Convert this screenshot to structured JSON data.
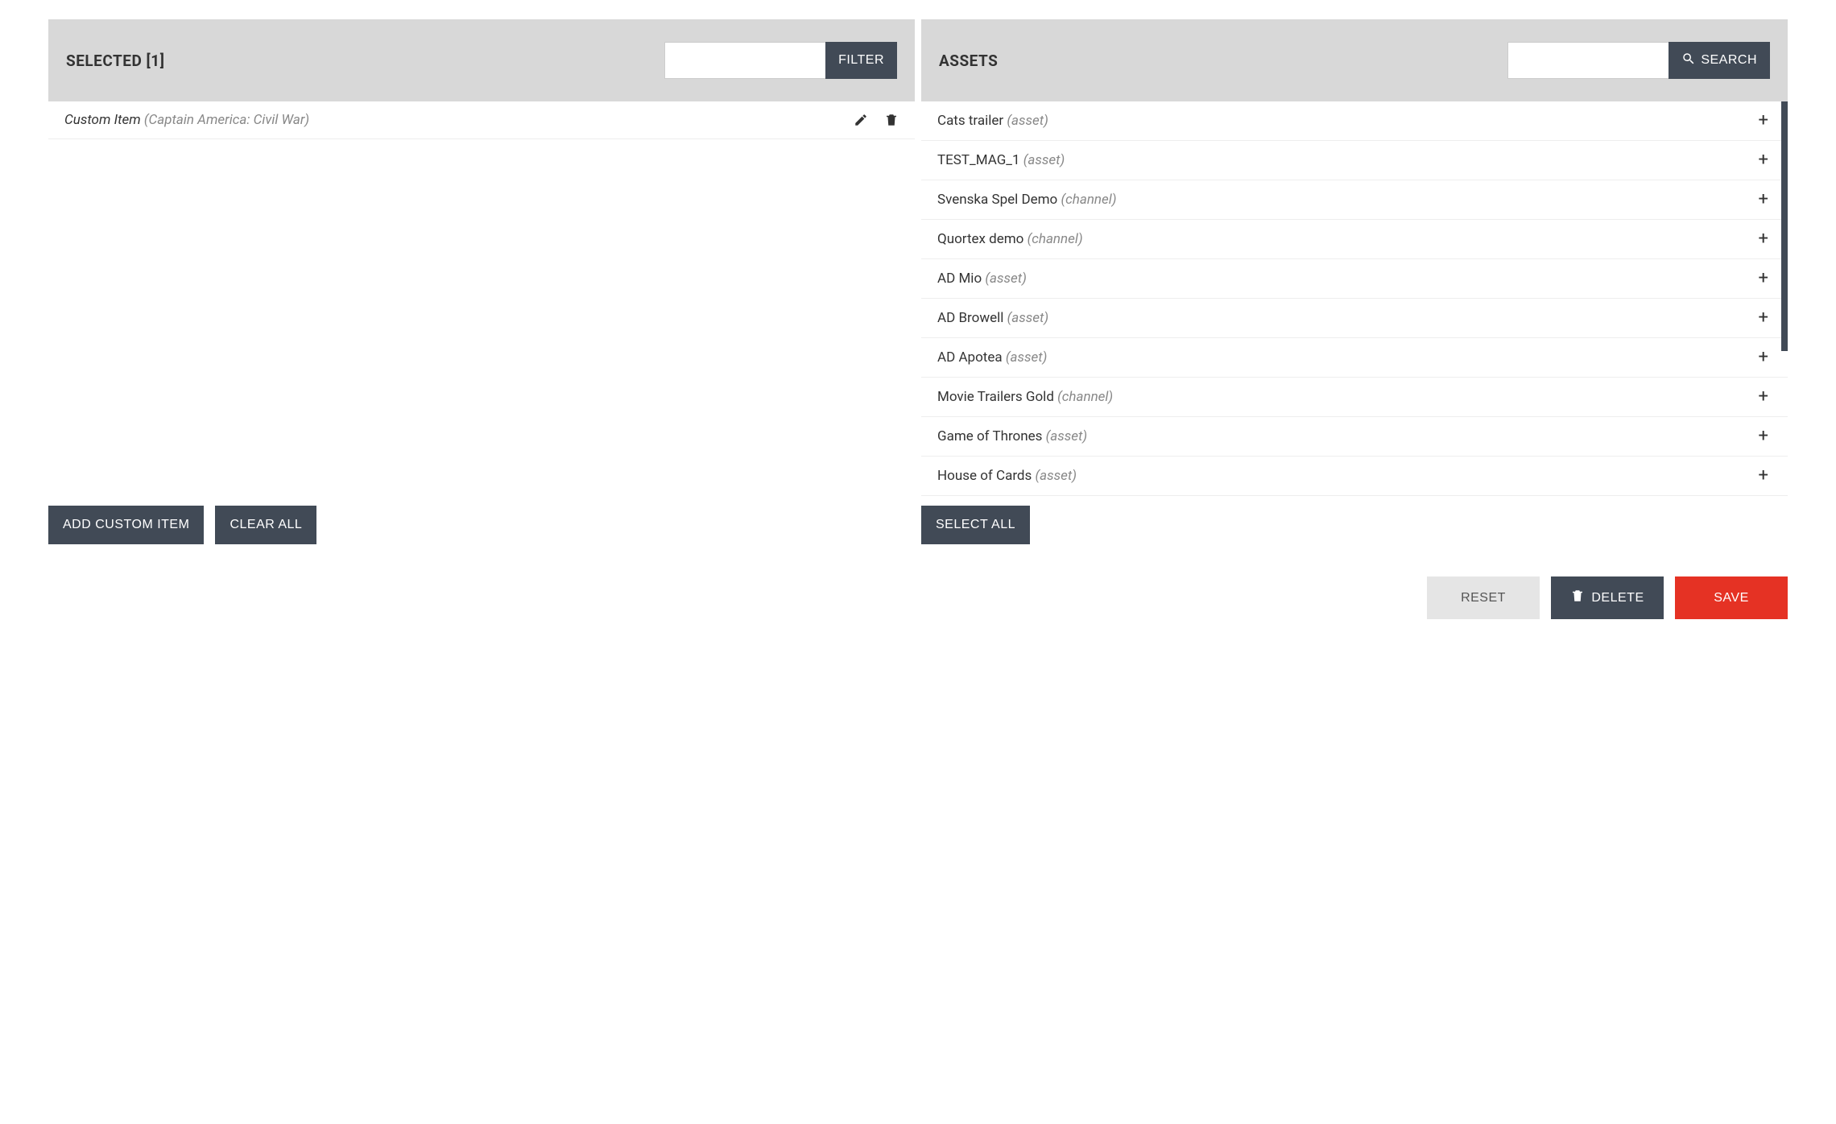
{
  "selected": {
    "title": "SELECTED [1]",
    "filter_btn": "FILTER",
    "filter_value": "",
    "items": [
      {
        "name": "Custom Item",
        "meta": "(Captain America: Civil War)"
      }
    ],
    "add_custom_btn": "ADD CUSTOM ITEM",
    "clear_all_btn": "CLEAR ALL"
  },
  "assets": {
    "title": "ASSETS",
    "search_btn": "SEARCH",
    "search_value": "",
    "items": [
      {
        "name": "Cats trailer",
        "meta": "(asset)"
      },
      {
        "name": "TEST_MAG_1",
        "meta": "(asset)"
      },
      {
        "name": "Svenska Spel Demo",
        "meta": "(channel)"
      },
      {
        "name": "Quortex demo",
        "meta": "(channel)"
      },
      {
        "name": "AD Mio",
        "meta": "(asset)"
      },
      {
        "name": "AD Browell",
        "meta": "(asset)"
      },
      {
        "name": "AD Apotea",
        "meta": "(asset)"
      },
      {
        "name": "Movie Trailers Gold",
        "meta": "(channel)"
      },
      {
        "name": "Game of Thrones",
        "meta": "(asset)"
      },
      {
        "name": "House of Cards",
        "meta": "(asset)"
      }
    ],
    "select_all_btn": "SELECT ALL"
  },
  "footer": {
    "reset": "RESET",
    "delete": "DELETE",
    "save": "SAVE"
  }
}
